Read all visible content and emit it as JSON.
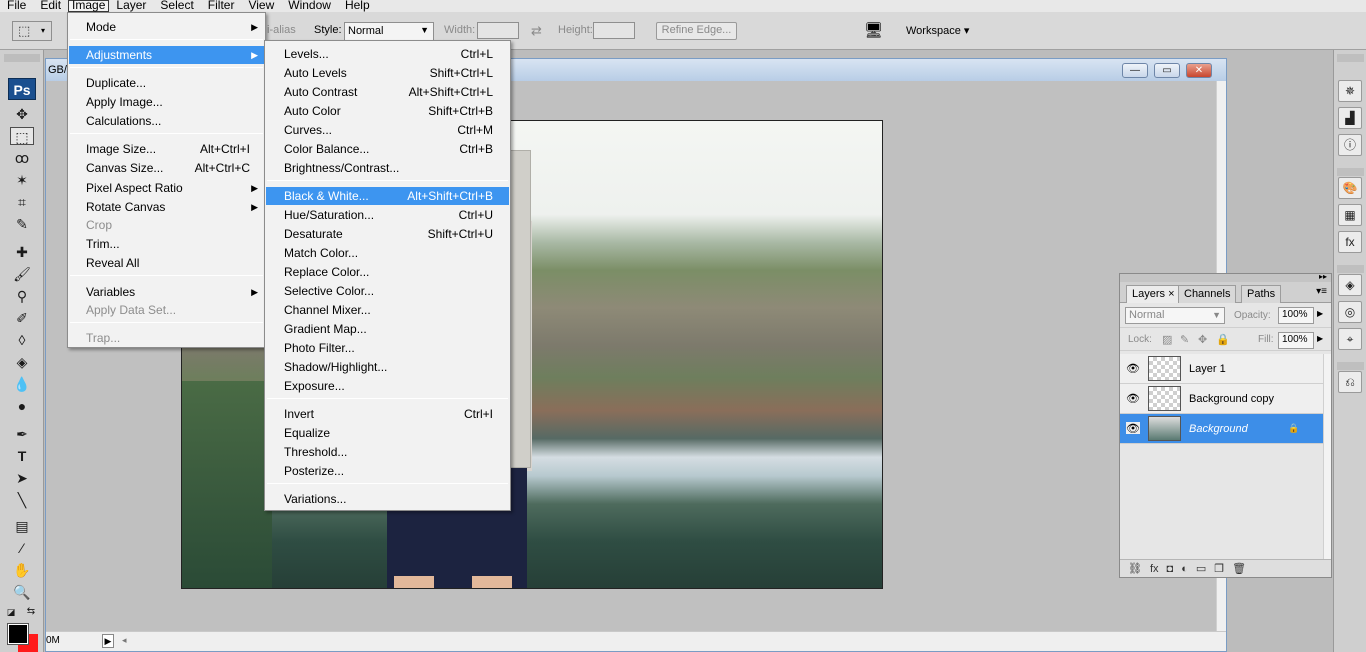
{
  "menubar": {
    "items": [
      "File",
      "Edit",
      "Image",
      "Layer",
      "Select",
      "Filter",
      "View",
      "Window",
      "Help"
    ],
    "active": "Image"
  },
  "options": {
    "antialias_fragment": "i-alias",
    "style_label": "Style:",
    "style_value": "Normal",
    "width_label": "Width:",
    "height_label": "Height:",
    "refine_edge": "Refine Edge...",
    "workspace": "Workspace ▾"
  },
  "document": {
    "title_fragment": "GB/",
    "zoom_fragment": "0M"
  },
  "image_menu": {
    "items": [
      {
        "label": "Mode",
        "submenu": true
      },
      {
        "label": "Adjustments",
        "submenu": true,
        "highlighted": true
      },
      {
        "label": "Duplicate..."
      },
      {
        "label": "Apply Image..."
      },
      {
        "label": "Calculations..."
      },
      {
        "label": "Image Size...",
        "shortcut": "Alt+Ctrl+I"
      },
      {
        "label": "Canvas Size...",
        "shortcut": "Alt+Ctrl+C"
      },
      {
        "label": "Pixel Aspect Ratio",
        "submenu": true
      },
      {
        "label": "Rotate Canvas",
        "submenu": true
      },
      {
        "label": "Crop",
        "disabled": true
      },
      {
        "label": "Trim..."
      },
      {
        "label": "Reveal All"
      },
      {
        "label": "Variables",
        "submenu": true
      },
      {
        "label": "Apply Data Set...",
        "disabled": true
      },
      {
        "label": "Trap...",
        "disabled": true
      }
    ]
  },
  "adjustments_menu": {
    "items": [
      {
        "label": "Levels...",
        "shortcut": "Ctrl+L"
      },
      {
        "label": "Auto Levels",
        "shortcut": "Shift+Ctrl+L"
      },
      {
        "label": "Auto Contrast",
        "shortcut": "Alt+Shift+Ctrl+L"
      },
      {
        "label": "Auto Color",
        "shortcut": "Shift+Ctrl+B"
      },
      {
        "label": "Curves...",
        "shortcut": "Ctrl+M"
      },
      {
        "label": "Color Balance...",
        "shortcut": "Ctrl+B"
      },
      {
        "label": "Brightness/Contrast..."
      },
      {
        "label": "Black & White...",
        "shortcut": "Alt+Shift+Ctrl+B",
        "highlighted": true
      },
      {
        "label": "Hue/Saturation...",
        "shortcut": "Ctrl+U"
      },
      {
        "label": "Desaturate",
        "shortcut": "Shift+Ctrl+U"
      },
      {
        "label": "Match Color..."
      },
      {
        "label": "Replace Color..."
      },
      {
        "label": "Selective Color..."
      },
      {
        "label": "Channel Mixer..."
      },
      {
        "label": "Gradient Map..."
      },
      {
        "label": "Photo Filter..."
      },
      {
        "label": "Shadow/Highlight..."
      },
      {
        "label": "Exposure..."
      },
      {
        "label": "Invert",
        "shortcut": "Ctrl+I"
      },
      {
        "label": "Equalize"
      },
      {
        "label": "Threshold..."
      },
      {
        "label": "Posterize..."
      },
      {
        "label": "Variations..."
      }
    ]
  },
  "layers_panel": {
    "tabs": [
      "Layers ×",
      "Channels",
      "Paths"
    ],
    "active_tab": "Layers",
    "blend_mode": "Normal",
    "opacity_label": "Opacity:",
    "opacity_value": "100%",
    "lock_label": "Lock:",
    "fill_label": "Fill:",
    "fill_value": "100%",
    "layers": [
      {
        "name": "Layer 1",
        "thumb": "transparent"
      },
      {
        "name": "Background copy",
        "thumb": "transparent"
      },
      {
        "name": "Background",
        "thumb": "image",
        "selected": true,
        "locked": true
      }
    ],
    "footer_icons": [
      "link-icon",
      "fx-icon",
      "mask-icon",
      "adjustment-icon",
      "folder-icon",
      "new-layer-icon",
      "trash-icon"
    ]
  },
  "colors": {
    "highlight": "#3d95f0",
    "foreground": "#000000",
    "background": "#ff1a1a"
  }
}
